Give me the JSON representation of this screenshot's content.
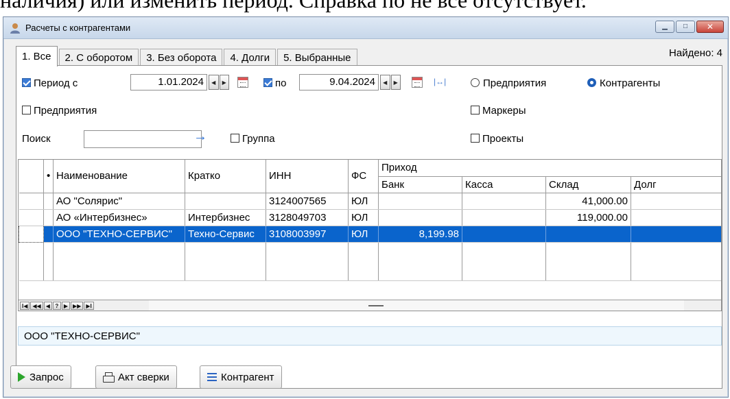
{
  "background_text": "наличия) или изменить период. Справка по не все отсутствует.",
  "window": {
    "title": "Расчеты с контрагентами",
    "buttons": {
      "minimize": "▁",
      "maximize": "□",
      "close": "✕"
    }
  },
  "tabs": [
    {
      "label": "1. Все",
      "active": true
    },
    {
      "label": "2. С оборотом",
      "active": false
    },
    {
      "label": "3. Без оборота",
      "active": false
    },
    {
      "label": "4. Долги",
      "active": false
    },
    {
      "label": "5. Выбранные",
      "active": false
    }
  ],
  "found": "Найдено: 4",
  "filters": {
    "period_from_label": "Период с",
    "period_from_value": "1.01.2024",
    "period_to_label": "по",
    "period_to_value": "9.04.2024",
    "radio_enterprises": "Предприятия",
    "radio_counterparties": "Контрагенты",
    "check_enterprises": "Предприятия",
    "check_markers": "Маркеры",
    "search_label": "Поиск",
    "search_value": "",
    "check_group": "Группа",
    "check_projects": "Проекты"
  },
  "grid": {
    "header_group": "Приход",
    "columns": [
      "•",
      "Наименование",
      "Кратко",
      "ИНН",
      "ФС",
      "Банк",
      "Касса",
      "Склад",
      "Долг"
    ],
    "rows": [
      {
        "name": "АО \"Солярис\"",
        "short": "",
        "inn": "3124007565",
        "fs": "ЮЛ",
        "bank": "",
        "kassa": "",
        "sklad": "41,000.00",
        "dolg": "",
        "selected": false
      },
      {
        "name": "АО «Интербизнес»",
        "short": "Интербизнес",
        "inn": "3128049703",
        "fs": "ЮЛ",
        "bank": "",
        "kassa": "",
        "sklad": "119,000.00",
        "dolg": "",
        "selected": false
      },
      {
        "name": "ООО \"ТЕХНО-СЕРВИС\"",
        "short": "Техно-Сервис",
        "inn": "3108003997",
        "fs": "ЮЛ",
        "bank": "8,199.98",
        "kassa": "",
        "sklad": "",
        "dolg": "",
        "selected": true
      }
    ],
    "nav_buttons": [
      "I◀",
      "◀◀",
      "◀",
      "?",
      "▶",
      "▶▶",
      "▶I"
    ]
  },
  "status_text": "ООО \"ТЕХНО-СЕРВИС\"",
  "buttons": {
    "query": "Запрос",
    "reconcile": "Акт сверки",
    "counterparty": "Контрагент"
  }
}
